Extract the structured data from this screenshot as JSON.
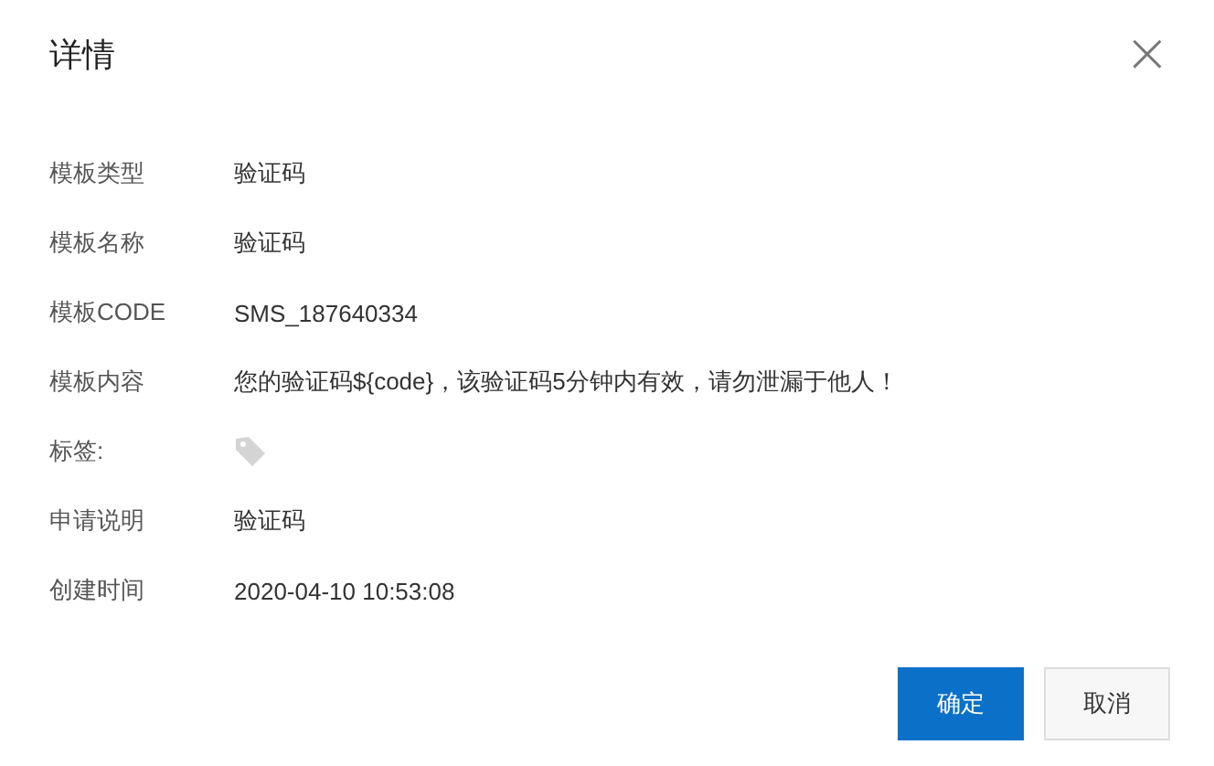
{
  "dialog": {
    "title": "详情",
    "close_label": "×"
  },
  "fields": [
    {
      "kind": "text",
      "label": "模板类型",
      "value": "验证码"
    },
    {
      "kind": "text",
      "label": "模板名称",
      "value": "验证码"
    },
    {
      "kind": "text",
      "label": "模板CODE",
      "value": "SMS_187640334"
    },
    {
      "kind": "text",
      "label": "模板内容",
      "value": "您的验证码${code}，该验证码5分钟内有效，请勿泄漏于他人！"
    },
    {
      "kind": "tag",
      "label": "标签:"
    },
    {
      "kind": "text",
      "label": "申请说明",
      "value": "验证码"
    },
    {
      "kind": "text",
      "label": "创建时间",
      "value": "2020-04-10 10:53:08"
    }
  ],
  "buttons": [
    {
      "kind": "primary",
      "label": "确定"
    },
    {
      "kind": "secondary",
      "label": "取消"
    }
  ]
}
